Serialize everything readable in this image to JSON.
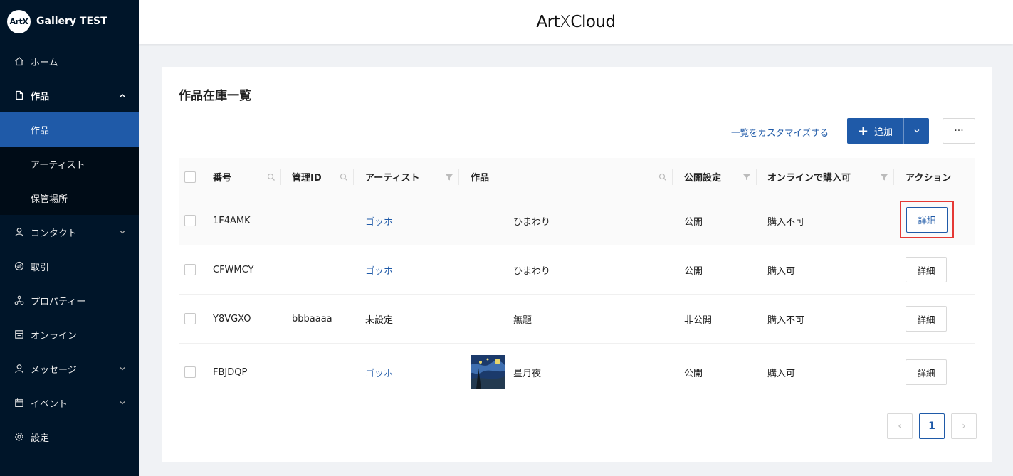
{
  "brand": {
    "logo_text": "ArtX",
    "name": "Gallery TEST"
  },
  "header": {
    "logo_left": "Art",
    "logo_x": "X",
    "logo_right": "Cloud"
  },
  "sidebar": {
    "items": [
      {
        "label": "ホーム",
        "icon": "home-icon"
      },
      {
        "label": "作品",
        "icon": "file-icon"
      },
      {
        "label": "作品",
        "active": true
      },
      {
        "label": "アーティスト"
      },
      {
        "label": "保管場所"
      },
      {
        "label": "コンタクト",
        "icon": "user-icon"
      },
      {
        "label": "取引",
        "icon": "transaction-icon"
      },
      {
        "label": "プロパティー",
        "icon": "cluster-icon"
      },
      {
        "label": "オンライン",
        "icon": "shop-icon"
      },
      {
        "label": "メッセージ",
        "icon": "user-icon"
      },
      {
        "label": "イベント",
        "icon": "calendar-icon"
      },
      {
        "label": "設定",
        "icon": "gear-icon"
      }
    ]
  },
  "main": {
    "title": "作品在庫一覧",
    "customize_label": "一覧をカスタマイズする",
    "add_label": "追加",
    "more_label": "···"
  },
  "table": {
    "columns": {
      "number": "番号",
      "manage_id": "管理ID",
      "artist": "アーティスト",
      "work": "作品",
      "public": "公開設定",
      "online": "オンラインで購入可",
      "action": "アクション"
    },
    "rows": [
      {
        "number": "1F4AMK",
        "manage_id": "",
        "artist": "ゴッホ",
        "artist_link": true,
        "work": "ひまわり",
        "public": "公開",
        "online": "購入不可",
        "action": "詳細"
      },
      {
        "number": "CFWMCY",
        "manage_id": "",
        "artist": "ゴッホ",
        "artist_link": true,
        "work": "ひまわり",
        "public": "公開",
        "online": "購入可",
        "action": "詳細"
      },
      {
        "number": "Y8VGXO",
        "manage_id": "bbbaaaa",
        "artist": "未設定",
        "artist_link": false,
        "work": "無題",
        "public": "非公開",
        "online": "購入不可",
        "action": "詳細"
      },
      {
        "number": "FBJDQP",
        "manage_id": "",
        "artist": "ゴッホ",
        "artist_link": true,
        "work": "星月夜",
        "public": "公開",
        "online": "購入可",
        "action": "詳細"
      }
    ]
  },
  "pagination": {
    "prev": "‹",
    "current": "1",
    "next": "›"
  },
  "colors": {
    "sidebar_bg": "#001529",
    "accent": "#1f5aa8",
    "highlight": "#e53935"
  }
}
